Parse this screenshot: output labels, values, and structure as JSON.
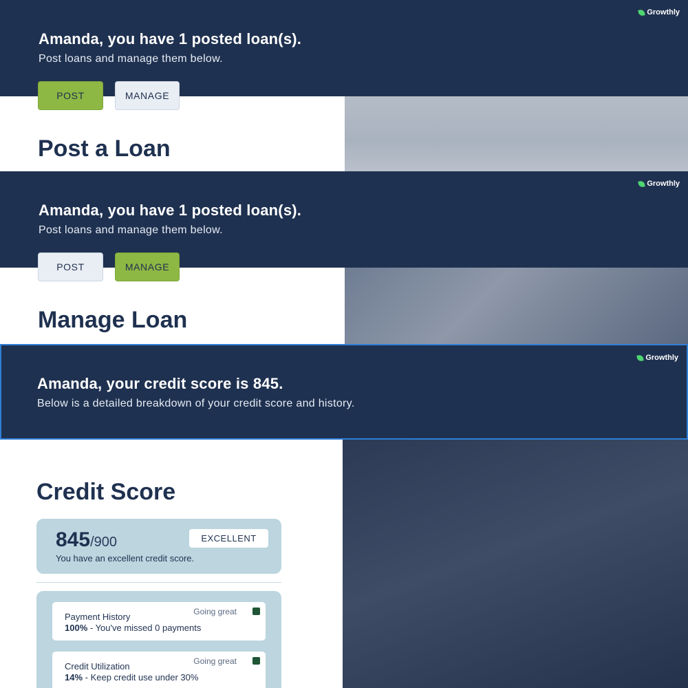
{
  "brand": {
    "name": "Growthly"
  },
  "post_screen": {
    "headline": "Amanda, you have 1 posted loan(s).",
    "subtitle": "Post loans and manage them below.",
    "post_label": "POST",
    "manage_label": "MANAGE",
    "active_tab": "POST",
    "section_title": "Post a Loan"
  },
  "manage_screen": {
    "headline": "Amanda, you have 1 posted loan(s).",
    "subtitle": "Post loans and manage them below.",
    "post_label": "POST",
    "manage_label": "MANAGE",
    "active_tab": "MANAGE",
    "section_title": "Manage Loan"
  },
  "credit_screen": {
    "headline": "Amanda, your credit score is 845.",
    "subtitle": "Below is a detailed breakdown of your credit score and history.",
    "section_title": "Credit Score",
    "score": "845",
    "score_max": "/900",
    "rating": "EXCELLENT",
    "score_desc": "You have an excellent credit score.",
    "factors": [
      {
        "label": "Payment History",
        "value": "100%",
        "detail": " - You've missed 0 payments",
        "status": "Going great"
      },
      {
        "label": "Credit Utilization",
        "value": "14%",
        "detail": " - Keep credit use under 30%",
        "status": "Going great"
      }
    ]
  },
  "colors": {
    "navy": "#1f3150",
    "accent_green": "#8db843",
    "light_button": "#e9eef4",
    "card_blue": "#bcd5df",
    "status_green": "#1f5534"
  }
}
